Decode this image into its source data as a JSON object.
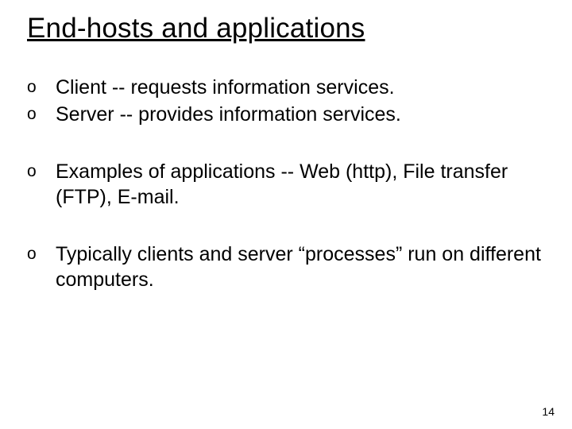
{
  "title": "End-hosts and applications",
  "bullet_marker": "o",
  "groups": [
    [
      "Client -- requests information services.",
      "Server -- provides information services."
    ],
    [
      "Examples of applications -- Web (http), File transfer (FTP), E-mail."
    ],
    [
      "Typically clients and server “processes” run on different computers."
    ]
  ],
  "page_number": "14"
}
